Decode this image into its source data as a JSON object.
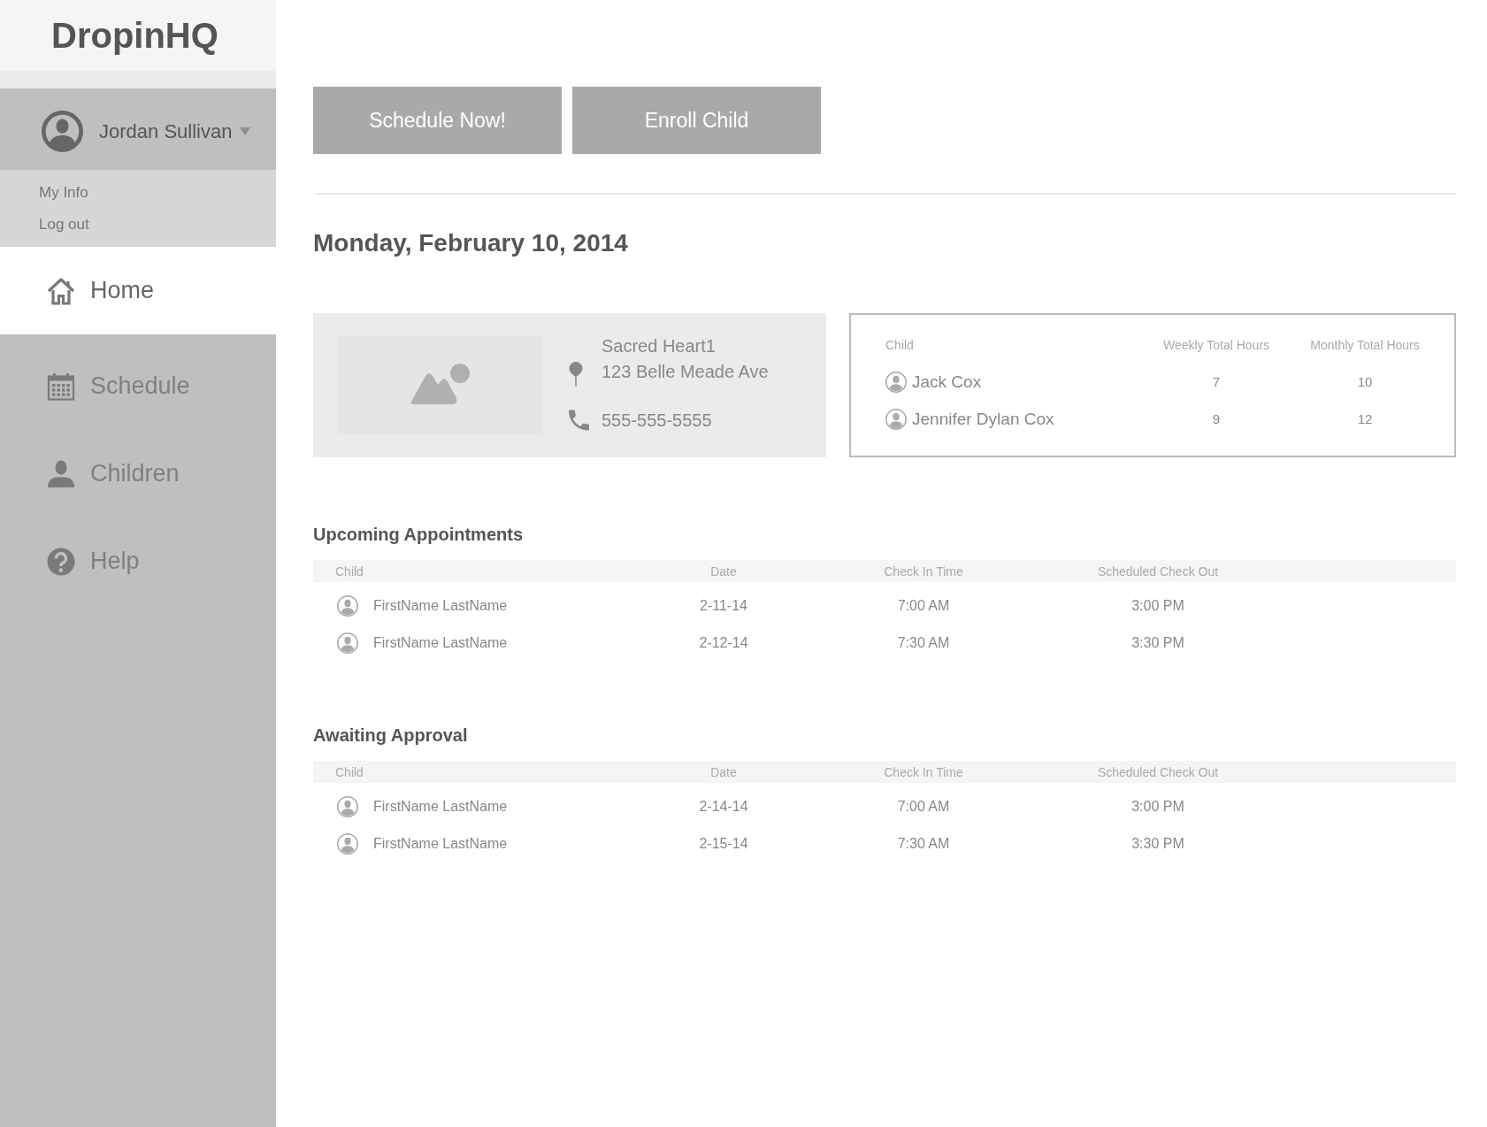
{
  "logo": "DropinHQ",
  "user": {
    "name": "Jordan Sullivan",
    "expanded": true,
    "menu": [
      "My Info",
      "Log out"
    ]
  },
  "nav": [
    {
      "label": "Home",
      "kind": "home",
      "selected": true
    },
    {
      "label": "Schedule",
      "kind": "schedule",
      "selected": false
    },
    {
      "label": "Children",
      "kind": "children",
      "selected": false
    },
    {
      "label": "Help",
      "kind": "help",
      "selected": false
    }
  ],
  "actions": [
    "Schedule Now!",
    "Enroll Child"
  ],
  "date_heading": "Monday, February 10, 2014",
  "location": {
    "name": "Sacred Heart1",
    "address": "123 Belle Meade Ave",
    "phone": "555-555-5555"
  },
  "children_summary": {
    "columns": [
      "Child",
      "Weekly Total Hours",
      "Monthly Total Hours"
    ],
    "rows": [
      {
        "name": "Jack Cox",
        "weekly": "7",
        "monthly": "10"
      },
      {
        "name": "Jennifer Dylan Cox",
        "weekly": "9",
        "monthly": "12"
      }
    ]
  },
  "sections": [
    {
      "title": "Upcoming Appointments",
      "columns": [
        "Child",
        "Date",
        "Check In Time",
        "Scheduled Check Out"
      ],
      "rows": [
        {
          "child": "FirstName LastName",
          "date": "2-11-14",
          "check_in": "7:00 AM",
          "check_out": "3:00 PM"
        },
        {
          "child": "FirstName LastName",
          "date": "2-12-14",
          "check_in": "7:30 AM",
          "check_out": "3:30 PM"
        }
      ]
    },
    {
      "title": "Awaiting Approval",
      "columns": [
        "Child",
        "Date",
        "Check In Time",
        "Scheduled Check Out"
      ],
      "rows": [
        {
          "child": "FirstName LastName",
          "date": "2-14-14",
          "check_in": "7:00 AM",
          "check_out": "3:00 PM"
        },
        {
          "child": "FirstName LastName",
          "date": "2-15-14",
          "check_in": "7:30 AM",
          "check_out": "3:30 PM"
        }
      ]
    }
  ]
}
